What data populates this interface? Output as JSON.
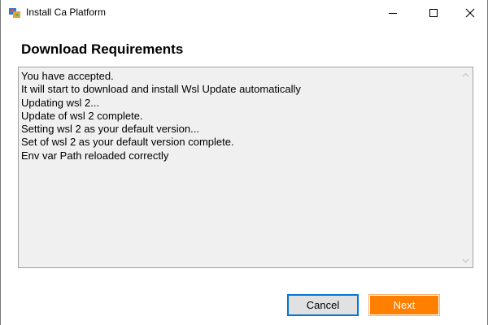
{
  "window": {
    "title": "Install Ca Platform",
    "icons": [
      "app-icon",
      "minimize-icon",
      "maximize-icon",
      "close-icon"
    ]
  },
  "page": {
    "heading": "Download Requirements"
  },
  "log": {
    "lines": [
      "You have accepted.",
      "It will start to download and install Wsl Update automatically",
      "Updating wsl 2...",
      "Update of wsl 2 complete.",
      "Setting wsl 2 as your default version...",
      "Set of wsl 2 as your default version complete.",
      "Env var Path reloaded correctly"
    ]
  },
  "buttons": {
    "cancel_label": "Cancel",
    "next_label": "Next"
  },
  "colors": {
    "accent_focus": "#0078d7",
    "next_button": "#ff7f00",
    "log_background": "#f0f0f0"
  }
}
